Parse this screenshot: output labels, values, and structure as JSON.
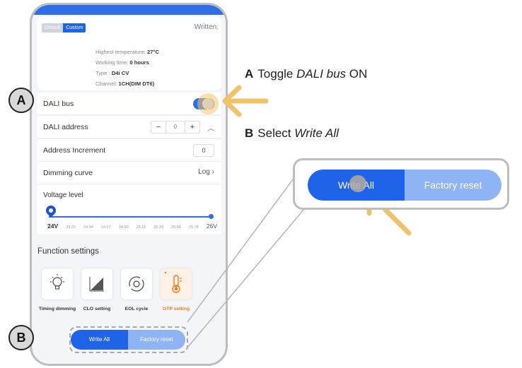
{
  "header": {
    "preset_default": "Default",
    "preset_custom": "Custom",
    "written_label": "Written:"
  },
  "device_info": {
    "highest_temp_label": "Highest temperature:",
    "highest_temp_value": "27°C",
    "working_time_label": "Working time:",
    "working_time_value": "0 hours",
    "type_label": "Type :",
    "type_value": "D4i CV",
    "channel_label": "Channel:",
    "channel_value": "1CH(DIM DT6)"
  },
  "settings": {
    "dali_bus_label": "DALI bus",
    "dali_bus_on": true,
    "dali_address_label": "DALI address",
    "dali_address_value": "0",
    "minus": "−",
    "plus": "+",
    "address_increment_label": "Address Increment",
    "address_increment_value": "0",
    "dimming_curve_label": "Dimming curve",
    "dimming_curve_value": "Log"
  },
  "voltage": {
    "label": "Voltage level",
    "min_label": "24V",
    "max_label": "26V",
    "ticks": [
      "24.22",
      "24.44",
      "24.67",
      "24.89",
      "25.11",
      "25.33",
      "25.56",
      "25.78"
    ],
    "level": 0.0
  },
  "functions": {
    "title": "Function settings",
    "items": [
      {
        "label": "Timing dimming",
        "icon": "bulb-icon"
      },
      {
        "label": "CLO setting",
        "icon": "bar-chart-icon"
      },
      {
        "label": "EOL cycle",
        "icon": "cycle-icon"
      },
      {
        "label": "OTP setting",
        "icon": "thermometer-icon"
      }
    ]
  },
  "actions": {
    "write_all": "Write All",
    "factory_reset": "Factory reset"
  },
  "instructions": {
    "a_marker": "A",
    "a_letter": "A",
    "a_text_1": "Toggle",
    "a_text_em": "DALI bus",
    "a_text_2": "ON",
    "b_marker": "B",
    "b_letter": "B",
    "b_text_1": "Select",
    "b_text_em": "Write All"
  },
  "colors": {
    "primary": "#1f63e8",
    "secondary": "#8fb4f5",
    "accent_arrow": "#f0c36b",
    "otp_orange": "#f07a19"
  }
}
